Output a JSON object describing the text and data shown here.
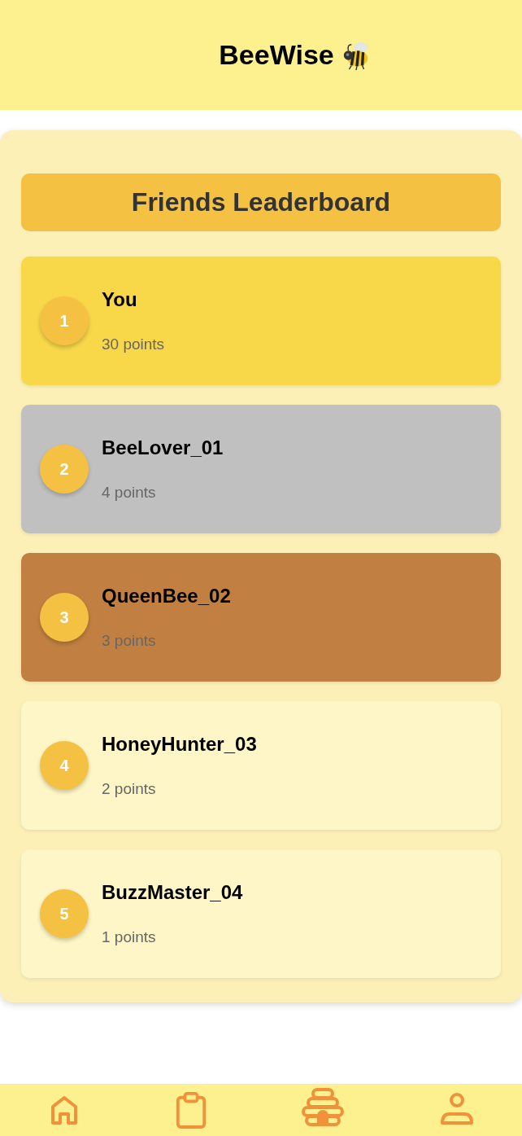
{
  "header": {
    "title": "BeeWise"
  },
  "leaderboard": {
    "title": "Friends Leaderboard",
    "entries": [
      {
        "rank": "1",
        "name": "You",
        "points": "30 points",
        "color": "#f8d749"
      },
      {
        "rank": "2",
        "name": "BeeLover_01",
        "points": "4 points",
        "color": "#c0c0c0"
      },
      {
        "rank": "3",
        "name": "QueenBee_02",
        "points": "3 points",
        "color": "#c18041"
      },
      {
        "rank": "4",
        "name": "HoneyHunter_03",
        "points": "2 points",
        "color": "#fef6c6"
      },
      {
        "rank": "5",
        "name": "BuzzMaster_04",
        "points": "1 points",
        "color": "#fef6c6"
      }
    ]
  },
  "nav": [
    {
      "kind": "home"
    },
    {
      "kind": "clipboard"
    },
    {
      "kind": "hive"
    },
    {
      "kind": "profile"
    }
  ]
}
